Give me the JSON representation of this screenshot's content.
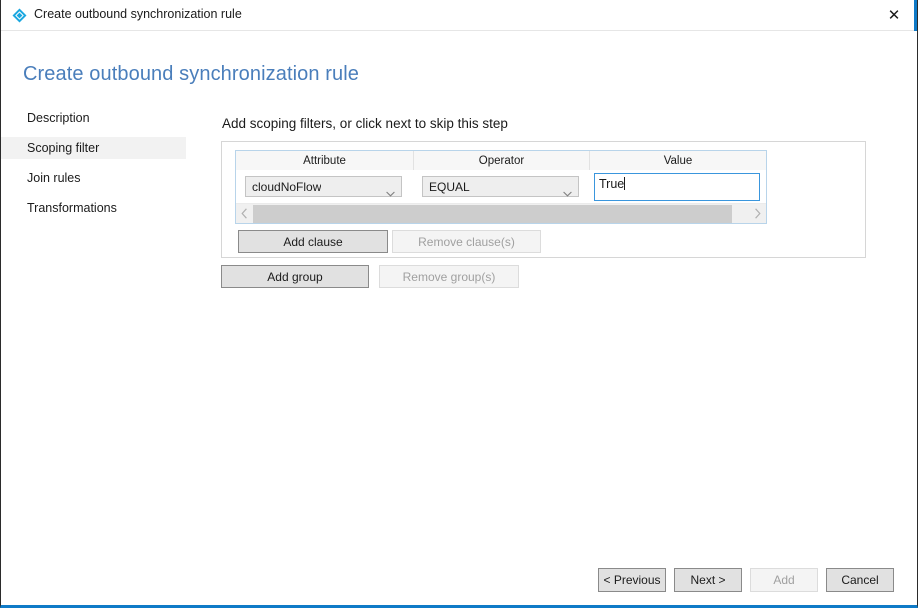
{
  "window": {
    "titlebar": {
      "title": "Create outbound synchronization rule",
      "icon": "sync-rule-diamond-icon",
      "close_label": "✕"
    },
    "accent_color": "#0f7ac7"
  },
  "page": {
    "heading": "Create outbound synchronization rule",
    "heading_color": "#4a7ebb"
  },
  "sidebar": {
    "items": [
      {
        "label": "Description",
        "selected": false
      },
      {
        "label": "Scoping filter",
        "selected": true
      },
      {
        "label": "Join rules",
        "selected": false
      },
      {
        "label": "Transformations",
        "selected": false
      }
    ]
  },
  "main": {
    "content_title": "Add scoping filters, or click next to skip this step",
    "clause_table": {
      "columns": [
        "Attribute",
        "Operator",
        "Value"
      ],
      "rows": [
        {
          "attribute": "cloudNoFlow",
          "operator": "EQUAL",
          "value": "True",
          "value_focused": true
        }
      ],
      "scrollbar": {
        "left_arrow": "chevron-left",
        "right_arrow": "chevron-right",
        "thumb_position_percent": 0
      }
    },
    "clause_buttons": {
      "add": {
        "label": "Add clause",
        "enabled": true
      },
      "remove": {
        "label": "Remove clause(s)",
        "enabled": false
      }
    },
    "group_buttons": {
      "add": {
        "label": "Add group",
        "enabled": true
      },
      "remove": {
        "label": "Remove group(s)",
        "enabled": false
      }
    }
  },
  "footer": {
    "buttons": [
      {
        "label": "< Previous",
        "enabled": true
      },
      {
        "label": "Next >",
        "enabled": true
      },
      {
        "label": "Add",
        "enabled": false
      },
      {
        "label": "Cancel",
        "enabled": true
      }
    ]
  }
}
